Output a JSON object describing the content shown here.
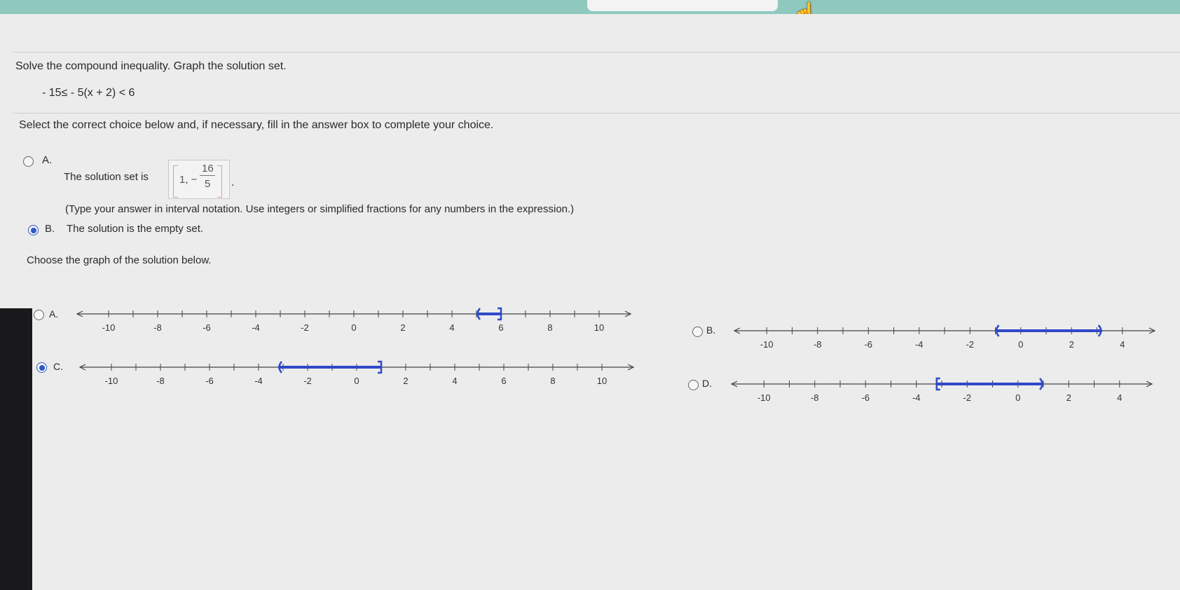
{
  "question": {
    "instruction": "Solve the compound inequality. Graph the solution set.",
    "inequality": "- 15≤ - 5(x + 2) < 6",
    "select_prompt": "Select the correct choice below and, if necessary, fill in the answer box to complete your choice."
  },
  "choices": [
    {
      "letter": "A.",
      "text_before": "The solution set is",
      "answer_whole": "1, −",
      "answer_num": "16",
      "answer_den": "5",
      "text_after": ".",
      "hint": "(Type your answer in interval notation. Use integers or simplified fractions for any numbers in the expression.)",
      "selected": false
    },
    {
      "letter": "B.",
      "text": "The solution is the empty set.",
      "selected": true
    }
  ],
  "graph_prompt": "Choose the graph of the solution below.",
  "graph_choices": [
    {
      "letter": "A.",
      "selected": false,
      "tick_labels": [
        "-10",
        "-8",
        "-6",
        "-4",
        "-2",
        "0",
        "2",
        "4",
        "6",
        "8",
        "10"
      ],
      "interval": {
        "from": 5,
        "to": 6,
        "left": "open",
        "right": "closed"
      }
    },
    {
      "letter": "B.",
      "selected": false,
      "tick_labels": [
        "-10",
        "-8",
        "-6",
        "-4",
        "-2",
        "0",
        "2",
        "4"
      ],
      "interval": {
        "from": -1,
        "to": 3.2,
        "left": "open",
        "right": "open"
      }
    },
    {
      "letter": "C.",
      "selected": true,
      "tick_labels": [
        "-10",
        "-8",
        "-6",
        "-4",
        "-2",
        "0",
        "2",
        "4",
        "6",
        "8",
        "10"
      ],
      "interval": {
        "from": -3.2,
        "to": 1,
        "left": "open",
        "right": "closed"
      }
    },
    {
      "letter": "D.",
      "selected": false,
      "tick_labels": [
        "-10",
        "-8",
        "-6",
        "-4",
        "-2",
        "0",
        "2",
        "4"
      ],
      "interval": {
        "from": -3.2,
        "to": 1,
        "left": "closed",
        "right": "open"
      }
    }
  ],
  "colors": {
    "accent": "#2c59c6",
    "graph": "#2f49c9"
  }
}
